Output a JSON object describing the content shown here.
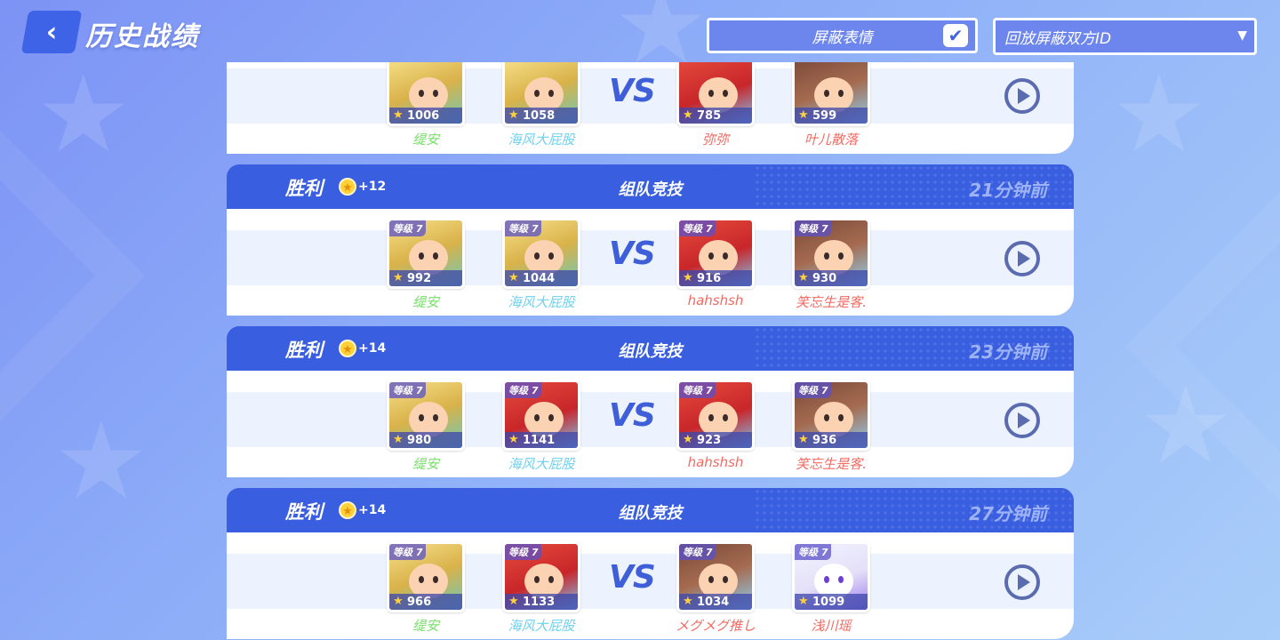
{
  "header": {
    "title": "历史战绩",
    "hide_emotes_label": "屏蔽表情",
    "hide_emotes_checked": true,
    "replay_hide_ids_label": "回放屏蔽双方ID"
  },
  "vs_label": "VS",
  "matches": [
    {
      "partial": true,
      "players": [
        {
          "name": "缇安",
          "level": "",
          "score": "1006",
          "hero": "hero-a",
          "side": "ally-1"
        },
        {
          "name": "海风大屁股",
          "level": "",
          "score": "1058",
          "hero": "hero-a",
          "side": "ally-2"
        },
        {
          "name": "弥弥",
          "level": "",
          "score": "785",
          "hero": "hero-b",
          "side": "enemy"
        },
        {
          "name": "叶儿散落",
          "level": "",
          "score": "599",
          "hero": "hero-c",
          "side": "enemy"
        }
      ]
    },
    {
      "result": "胜利",
      "star_delta": "+12",
      "mode": "组队竞技",
      "time": "21分钟前",
      "players": [
        {
          "name": "缇安",
          "level": "等级 7",
          "score": "992",
          "hero": "hero-a",
          "side": "ally-1"
        },
        {
          "name": "海风大屁股",
          "level": "等级 7",
          "score": "1044",
          "hero": "hero-a",
          "side": "ally-2"
        },
        {
          "name": "hahshsh",
          "level": "等级 7",
          "score": "916",
          "hero": "hero-b",
          "side": "enemy"
        },
        {
          "name": "笑忘生是客.",
          "level": "等级 7",
          "score": "930",
          "hero": "hero-c",
          "side": "enemy"
        }
      ]
    },
    {
      "result": "胜利",
      "star_delta": "+14",
      "mode": "组队竞技",
      "time": "23分钟前",
      "players": [
        {
          "name": "缇安",
          "level": "等级 7",
          "score": "980",
          "hero": "hero-a",
          "side": "ally-1"
        },
        {
          "name": "海风大屁股",
          "level": "等级 7",
          "score": "1141",
          "hero": "hero-b",
          "side": "ally-2"
        },
        {
          "name": "hahshsh",
          "level": "等级 7",
          "score": "923",
          "hero": "hero-b",
          "side": "enemy"
        },
        {
          "name": "笑忘生是客.",
          "level": "等级 7",
          "score": "936",
          "hero": "hero-c",
          "side": "enemy"
        }
      ]
    },
    {
      "result": "胜利",
      "star_delta": "+14",
      "mode": "组队竞技",
      "time": "27分钟前",
      "players": [
        {
          "name": "缇安",
          "level": "等级 7",
          "score": "966",
          "hero": "hero-a",
          "side": "ally-1"
        },
        {
          "name": "海风大屁股",
          "level": "等级 7",
          "score": "1133",
          "hero": "hero-b",
          "side": "ally-2"
        },
        {
          "name": "メグメグ推し",
          "level": "等级 7",
          "score": "1034",
          "hero": "hero-c",
          "side": "enemy"
        },
        {
          "name": "浅川瑶",
          "level": "等级 7",
          "score": "1099",
          "hero": "hero-d",
          "side": "enemy"
        }
      ]
    }
  ]
}
